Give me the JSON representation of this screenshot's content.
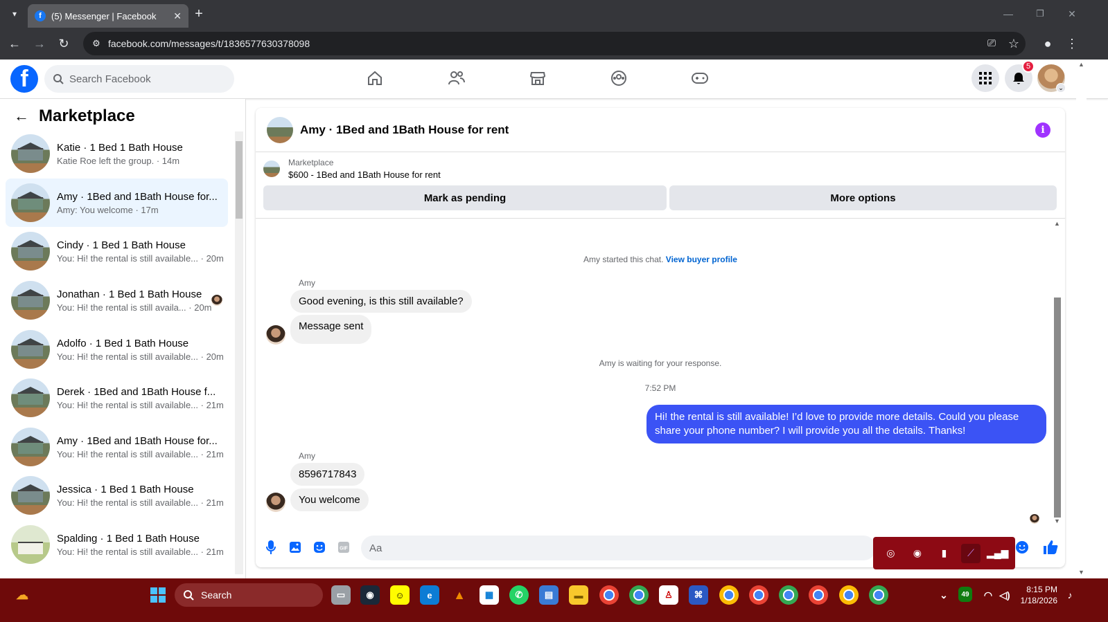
{
  "browser": {
    "tab_title": "(5) Messenger | Facebook",
    "url": "facebook.com/messages/t/1836577630378098"
  },
  "fb": {
    "search_placeholder": "Search Facebook",
    "notification_count": "5"
  },
  "sidebar": {
    "title": "Marketplace",
    "conversations": [
      {
        "name": "Katie · 1 Bed 1 Bath House",
        "snippet": "Katie Roe left the group. · 14m"
      },
      {
        "name": "Amy · 1Bed and 1Bath House for...",
        "snippet": "Amy: You welcome · 17m"
      },
      {
        "name": "Cindy · 1 Bed 1 Bath House",
        "snippet": "You: Hi! the rental is still available... · 20m"
      },
      {
        "name": "Jonathan · 1 Bed 1 Bath House",
        "snippet": "You: Hi! the rental is still availa... · 20m"
      },
      {
        "name": "Adolfo · 1 Bed 1 Bath House",
        "snippet": "You: Hi! the rental is still available... · 20m"
      },
      {
        "name": "Derek · 1Bed and 1Bath House f...",
        "snippet": "You: Hi! the rental is still available... · 21m"
      },
      {
        "name": "Amy · 1Bed and 1Bath House for...",
        "snippet": "You: Hi! the rental is still available... · 21m"
      },
      {
        "name": "Jessica · 1 Bed 1 Bath House",
        "snippet": "You: Hi! the rental is still available... · 21m"
      },
      {
        "name": "Spalding · 1 Bed 1 Bath House",
        "snippet": "You: Hi! the rental is still available... · 21m"
      }
    ]
  },
  "chat": {
    "title": "Amy · 1Bed and 1Bath House for rent",
    "listing_label": "Marketplace",
    "listing_title": "$600 - 1Bed and 1Bath House for rent",
    "mark_pending": "Mark as pending",
    "more_options": "More options",
    "started_text": "Amy started this chat.",
    "view_profile": "View buyer profile",
    "sender_name": "Amy",
    "msg1": "Good evening, is this still available?",
    "msg2": "Message sent",
    "waiting": "Amy is waiting for your response.",
    "time": "7:52 PM",
    "my_msg": "Hi! the rental is still available! I’d love to provide more details. Could you please share your phone number? I will provide you all the details. Thanks!",
    "sender_name2": "Amy",
    "msg3": "8596717843",
    "msg4": "You welcome",
    "composer_placeholder": "Aa"
  },
  "taskbar": {
    "search": "Search",
    "time": "8:15 PM",
    "date": "1/18/2026",
    "battery": "49"
  },
  "colors": {
    "fb_blue": "#0866ff",
    "my_bubble": "#3b53f5",
    "taskbar": "#6e0a0a"
  }
}
